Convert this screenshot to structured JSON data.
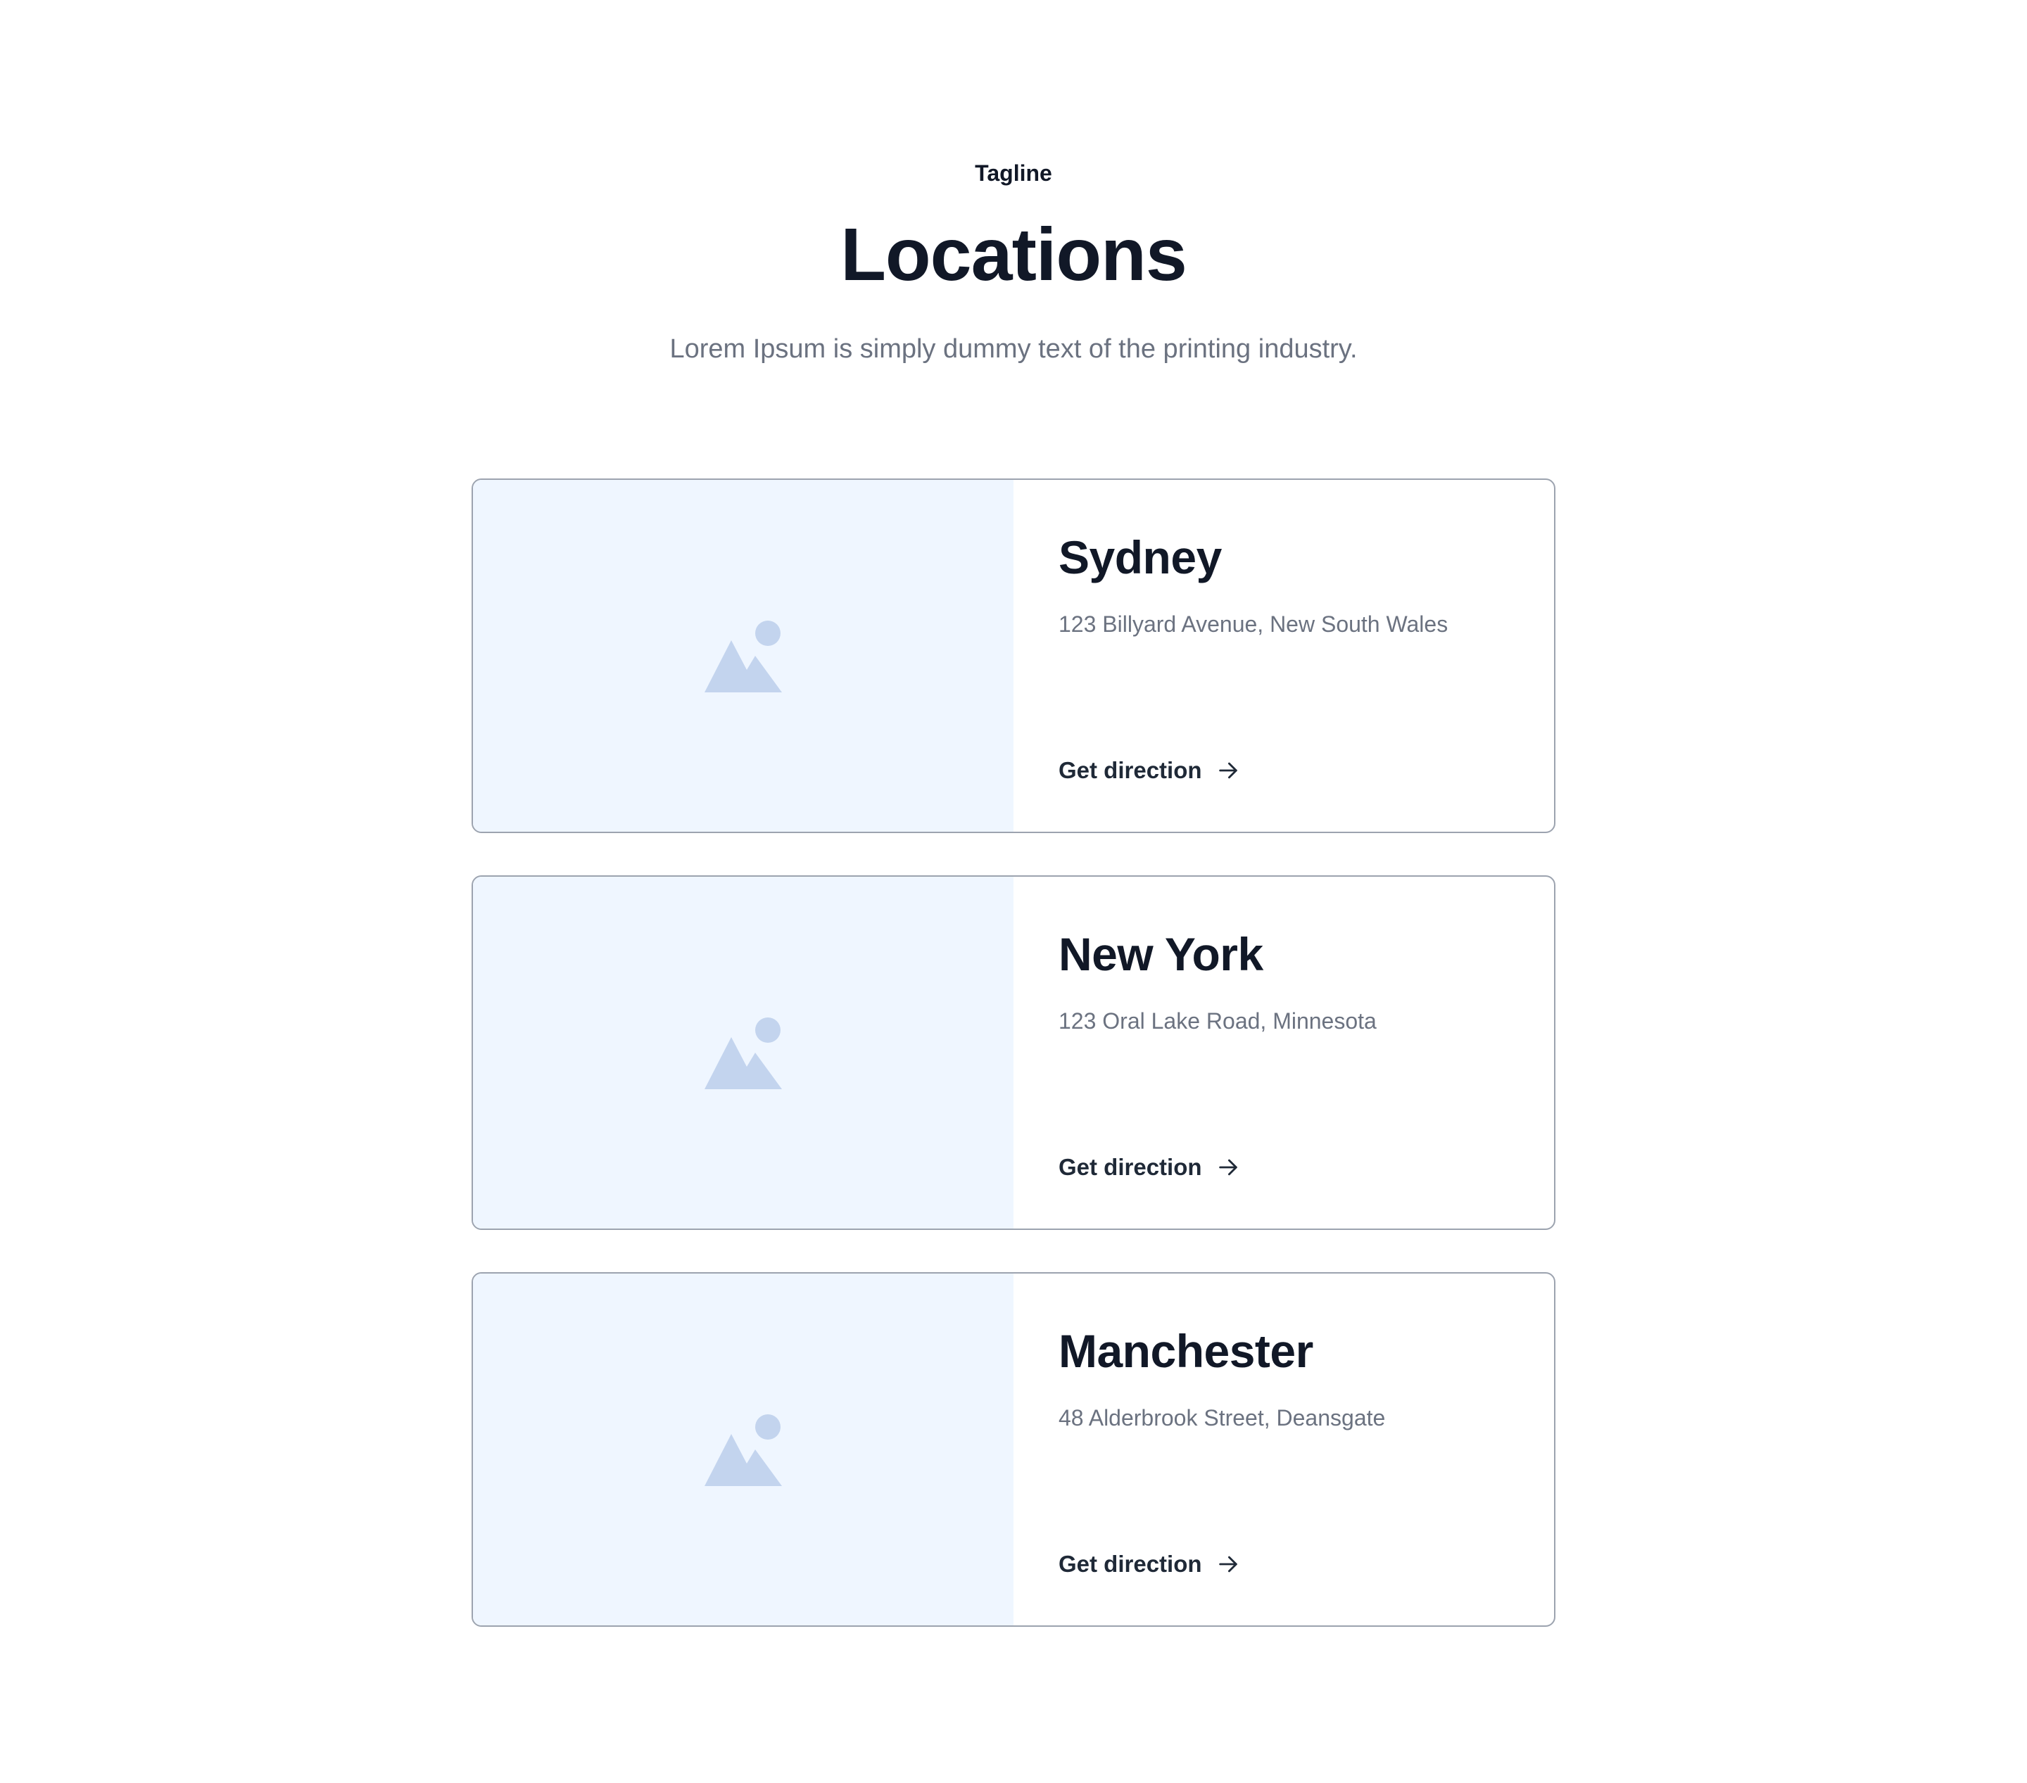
{
  "header": {
    "tagline": "Tagline",
    "title": "Locations",
    "subtitle": "Lorem Ipsum is simply dummy text of the printing industry."
  },
  "locations": [
    {
      "name": "Sydney",
      "address": "123 Billyard Avenue, New South Wales",
      "link_label": "Get direction",
      "image_icon": "image-placeholder-icon",
      "link_icon": "arrow-right-icon"
    },
    {
      "name": "New York",
      "address": "123 Oral Lake Road, Minnesota",
      "link_label": "Get direction",
      "image_icon": "image-placeholder-icon",
      "link_icon": "arrow-right-icon"
    },
    {
      "name": "Manchester",
      "address": "48 Alderbrook Street, Deansgate",
      "link_label": "Get direction",
      "image_icon": "image-placeholder-icon",
      "link_icon": "arrow-right-icon"
    }
  ],
  "colors": {
    "heading": "#111827",
    "muted_text": "#6b7280",
    "link_text": "#1f2937",
    "card_border": "#9ca3af",
    "image_bg": "#eff6ff",
    "placeholder_icon": "#c3d4ee"
  }
}
